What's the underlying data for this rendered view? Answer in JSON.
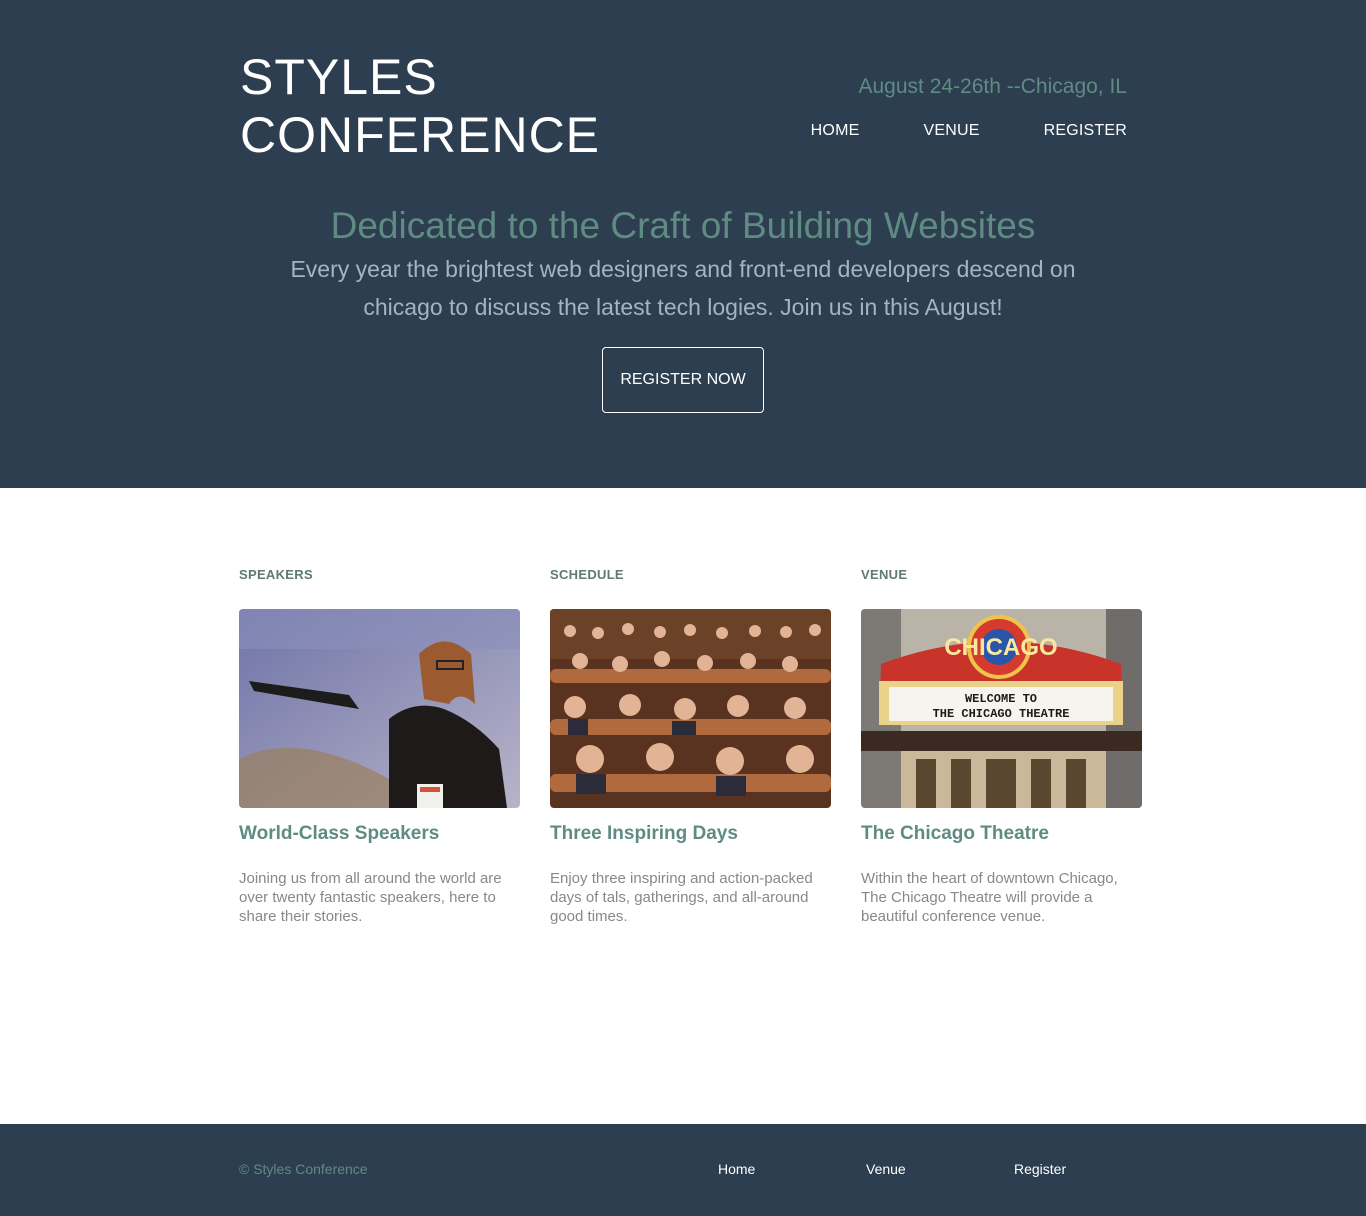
{
  "brand": {
    "line1": "STYLES",
    "line2": "CONFERENCE"
  },
  "header": {
    "tagline": "August 24-26th --Chicago, IL",
    "nav": [
      "HOME",
      "VENUE",
      "REGISTER"
    ]
  },
  "hero": {
    "headline": "Dedicated to the Craft of Building Websites",
    "lede": "Every year the brightest web designers and front-end developers descend on chicago to discuss the latest tech logies. Join us in this August!",
    "cta": "REGISTER NOW"
  },
  "sections": [
    {
      "label": "SPEAKERS",
      "title": "World-Class Speakers",
      "text": "Joining us from all around the world are over twenty fantastic speakers, here to share their stories."
    },
    {
      "label": "SCHEDULE",
      "title": "Three Inspiring Days",
      "text": "Enjoy three inspiring and action-packed days of tals, gatherings, and all-around good times."
    },
    {
      "label": "VENUE",
      "title": "The Chicago Theatre",
      "text": "Within the heart of downtown Chicago, The Chicago Theatre will provide a beautiful conference venue."
    }
  ],
  "venue_sign": {
    "marquee": "CHICAGO",
    "line1": "WELCOME TO",
    "line2": "THE CHICAGO THEATRE"
  },
  "footer": {
    "copyright": "© Styles Conference",
    "nav": [
      "Home",
      "Venue",
      "Register"
    ]
  },
  "colors": {
    "navy": "#2c3e50",
    "accent": "#5f8b83",
    "text": "#888888"
  }
}
